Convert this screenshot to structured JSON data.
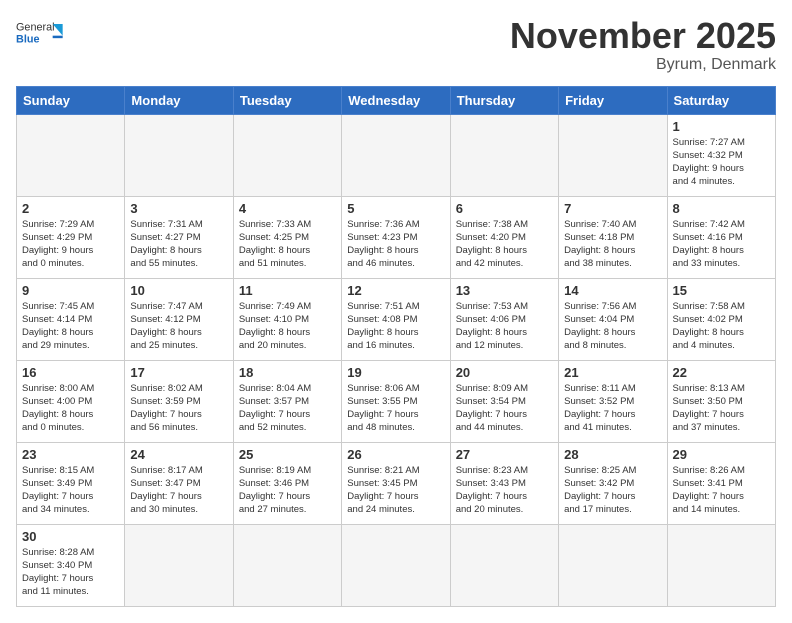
{
  "header": {
    "logo_general": "General",
    "logo_blue": "Blue",
    "month_title": "November 2025",
    "location": "Byrum, Denmark"
  },
  "weekdays": [
    "Sunday",
    "Monday",
    "Tuesday",
    "Wednesday",
    "Thursday",
    "Friday",
    "Saturday"
  ],
  "weeks": [
    [
      {
        "day": "",
        "empty": true,
        "info": ""
      },
      {
        "day": "",
        "empty": true,
        "info": ""
      },
      {
        "day": "",
        "empty": true,
        "info": ""
      },
      {
        "day": "",
        "empty": true,
        "info": ""
      },
      {
        "day": "",
        "empty": true,
        "info": ""
      },
      {
        "day": "",
        "empty": true,
        "info": ""
      },
      {
        "day": "1",
        "empty": false,
        "info": "Sunrise: 7:27 AM\nSunset: 4:32 PM\nDaylight: 9 hours\nand 4 minutes."
      }
    ],
    [
      {
        "day": "2",
        "empty": false,
        "info": "Sunrise: 7:29 AM\nSunset: 4:29 PM\nDaylight: 9 hours\nand 0 minutes."
      },
      {
        "day": "3",
        "empty": false,
        "info": "Sunrise: 7:31 AM\nSunset: 4:27 PM\nDaylight: 8 hours\nand 55 minutes."
      },
      {
        "day": "4",
        "empty": false,
        "info": "Sunrise: 7:33 AM\nSunset: 4:25 PM\nDaylight: 8 hours\nand 51 minutes."
      },
      {
        "day": "5",
        "empty": false,
        "info": "Sunrise: 7:36 AM\nSunset: 4:23 PM\nDaylight: 8 hours\nand 46 minutes."
      },
      {
        "day": "6",
        "empty": false,
        "info": "Sunrise: 7:38 AM\nSunset: 4:20 PM\nDaylight: 8 hours\nand 42 minutes."
      },
      {
        "day": "7",
        "empty": false,
        "info": "Sunrise: 7:40 AM\nSunset: 4:18 PM\nDaylight: 8 hours\nand 38 minutes."
      },
      {
        "day": "8",
        "empty": false,
        "info": "Sunrise: 7:42 AM\nSunset: 4:16 PM\nDaylight: 8 hours\nand 33 minutes."
      }
    ],
    [
      {
        "day": "9",
        "empty": false,
        "info": "Sunrise: 7:45 AM\nSunset: 4:14 PM\nDaylight: 8 hours\nand 29 minutes."
      },
      {
        "day": "10",
        "empty": false,
        "info": "Sunrise: 7:47 AM\nSunset: 4:12 PM\nDaylight: 8 hours\nand 25 minutes."
      },
      {
        "day": "11",
        "empty": false,
        "info": "Sunrise: 7:49 AM\nSunset: 4:10 PM\nDaylight: 8 hours\nand 20 minutes."
      },
      {
        "day": "12",
        "empty": false,
        "info": "Sunrise: 7:51 AM\nSunset: 4:08 PM\nDaylight: 8 hours\nand 16 minutes."
      },
      {
        "day": "13",
        "empty": false,
        "info": "Sunrise: 7:53 AM\nSunset: 4:06 PM\nDaylight: 8 hours\nand 12 minutes."
      },
      {
        "day": "14",
        "empty": false,
        "info": "Sunrise: 7:56 AM\nSunset: 4:04 PM\nDaylight: 8 hours\nand 8 minutes."
      },
      {
        "day": "15",
        "empty": false,
        "info": "Sunrise: 7:58 AM\nSunset: 4:02 PM\nDaylight: 8 hours\nand 4 minutes."
      }
    ],
    [
      {
        "day": "16",
        "empty": false,
        "info": "Sunrise: 8:00 AM\nSunset: 4:00 PM\nDaylight: 8 hours\nand 0 minutes."
      },
      {
        "day": "17",
        "empty": false,
        "info": "Sunrise: 8:02 AM\nSunset: 3:59 PM\nDaylight: 7 hours\nand 56 minutes."
      },
      {
        "day": "18",
        "empty": false,
        "info": "Sunrise: 8:04 AM\nSunset: 3:57 PM\nDaylight: 7 hours\nand 52 minutes."
      },
      {
        "day": "19",
        "empty": false,
        "info": "Sunrise: 8:06 AM\nSunset: 3:55 PM\nDaylight: 7 hours\nand 48 minutes."
      },
      {
        "day": "20",
        "empty": false,
        "info": "Sunrise: 8:09 AM\nSunset: 3:54 PM\nDaylight: 7 hours\nand 44 minutes."
      },
      {
        "day": "21",
        "empty": false,
        "info": "Sunrise: 8:11 AM\nSunset: 3:52 PM\nDaylight: 7 hours\nand 41 minutes."
      },
      {
        "day": "22",
        "empty": false,
        "info": "Sunrise: 8:13 AM\nSunset: 3:50 PM\nDaylight: 7 hours\nand 37 minutes."
      }
    ],
    [
      {
        "day": "23",
        "empty": false,
        "info": "Sunrise: 8:15 AM\nSunset: 3:49 PM\nDaylight: 7 hours\nand 34 minutes."
      },
      {
        "day": "24",
        "empty": false,
        "info": "Sunrise: 8:17 AM\nSunset: 3:47 PM\nDaylight: 7 hours\nand 30 minutes."
      },
      {
        "day": "25",
        "empty": false,
        "info": "Sunrise: 8:19 AM\nSunset: 3:46 PM\nDaylight: 7 hours\nand 27 minutes."
      },
      {
        "day": "26",
        "empty": false,
        "info": "Sunrise: 8:21 AM\nSunset: 3:45 PM\nDaylight: 7 hours\nand 24 minutes."
      },
      {
        "day": "27",
        "empty": false,
        "info": "Sunrise: 8:23 AM\nSunset: 3:43 PM\nDaylight: 7 hours\nand 20 minutes."
      },
      {
        "day": "28",
        "empty": false,
        "info": "Sunrise: 8:25 AM\nSunset: 3:42 PM\nDaylight: 7 hours\nand 17 minutes."
      },
      {
        "day": "29",
        "empty": false,
        "info": "Sunrise: 8:26 AM\nSunset: 3:41 PM\nDaylight: 7 hours\nand 14 minutes."
      }
    ],
    [
      {
        "day": "30",
        "empty": false,
        "info": "Sunrise: 8:28 AM\nSunset: 3:40 PM\nDaylight: 7 hours\nand 11 minutes."
      },
      {
        "day": "",
        "empty": true,
        "info": ""
      },
      {
        "day": "",
        "empty": true,
        "info": ""
      },
      {
        "day": "",
        "empty": true,
        "info": ""
      },
      {
        "day": "",
        "empty": true,
        "info": ""
      },
      {
        "day": "",
        "empty": true,
        "info": ""
      },
      {
        "day": "",
        "empty": true,
        "info": ""
      }
    ]
  ]
}
